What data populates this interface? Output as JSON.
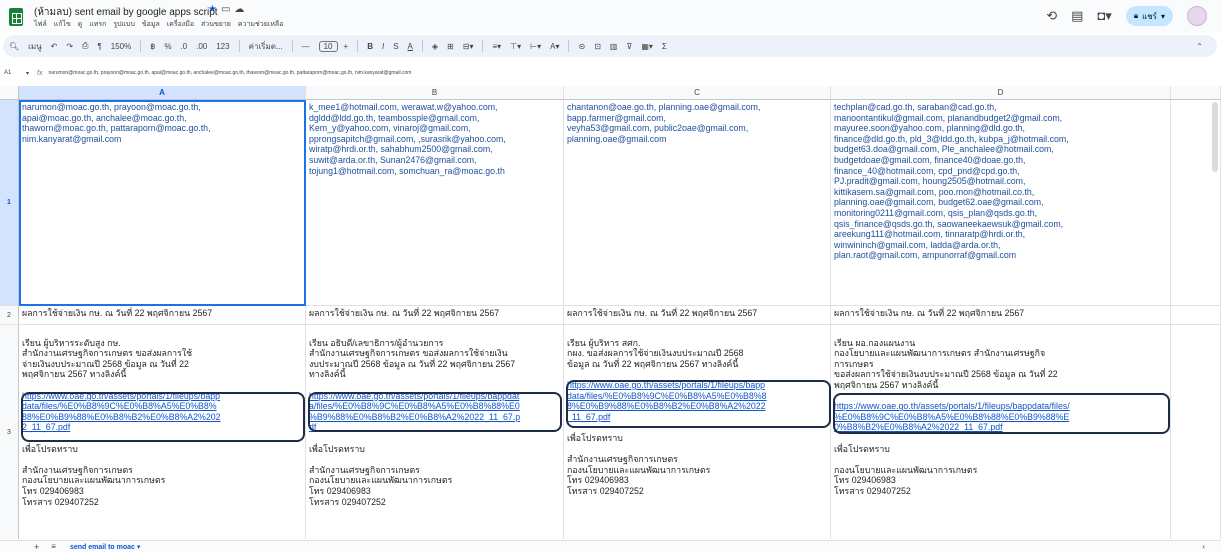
{
  "header": {
    "doc_title": "(ห้ามลบ) sent email by google apps script",
    "menu": [
      "ไฟล์",
      "แก้ไข",
      "ดู",
      "แทรก",
      "รูปแบบ",
      "ข้อมูล",
      "เครื่องมือ",
      "ส่วนขยาย",
      "ความช่วยเหลือ"
    ],
    "share_label": "แชร์"
  },
  "toolbar": {
    "menus_label": "เมนู",
    "zoom": "150%",
    "currency": "฿",
    "percent": "%",
    "dec_decrease": ".0",
    "dec_increase": ".00",
    "number_format": "123",
    "font": "ค่าเริ่มต...",
    "font_size": "10",
    "bold": "B",
    "italic": "I",
    "strike": "S",
    "text_color": "A",
    "function": "Σ"
  },
  "formula_bar": {
    "cell_ref": "A1",
    "fx": "fx",
    "content": "narumon@moac.go.th, prayoon@moac.go.th, apai@moac.go.th, anchalee@moac.go.th, thaworn@moac.go.th, pattaraporn@moac.go.th, nim.kanyarat@gmail.com"
  },
  "grid": {
    "columns": [
      "A",
      "B",
      "C",
      "D"
    ],
    "rows": [
      "1",
      "2",
      "3"
    ],
    "row1": [
      "narumon@moac.go.th, prayoon@moac.go.th,\napai@moac.go.th, anchalee@moac.go.th,\nthaworn@moac.go.th, pattaraporn@moac.go.th,\nnim.kanyarat@gmail.com",
      "k_mee1@hotmail.com, werawat.w@yahoo.com,\ndgldd@ldd.go.th, teambossple@gmail.com,\nKem_y@yahoo.com, vinaroj@gmail.com,\npprongsapitch@gmail.com, ,surasrik@yahoo.com,\nwiratp@hrdi.or.th, sahabhum2500@gmail.com,\nsuwit@arda.or.th, Sunan2476@gmail.com,\ntojung1@hotmail.com, somchuan_ra@moac.go.th",
      "chantanon@oae.go.th, planning.oae@gmail.com,\nbapp.farmer@gmail.com,\nveyha53@gmail.com, public2oae@gmail.com,\nplanning.oae@gmail.com",
      "techplan@cad.go.th, saraban@cad.go.th,\nmanoontantikul@gmail.com, planandbudget2@gmail.com,\nmayuree.soon@yahoo.com, planning@dld.go.th,\nfinance@dld.go.th, pld_3@ldd.go.th, kubpa_j@hotmail.com,\nbudget63.doa@gmail.com, Ple_anchalee@hotmail.com,\nbudgetdoae@gmail.com, finance40@doae.go.th,\nfinance_40@hotmail.com, cpd_pnd@cpd.go.th,\nPJ.pradit@gmail.com, houng2505@hotmail.com,\nkittikasem.sa@gmail.com, poo.mon@hotmail.co.th,\nplanning.oae@gmail.com, budget62.oae@gmail.com,\nmonitoring0211@gmail.com, qsis_plan@qsds.go.th,\nqsis_finance@qsds.go.th, saowaneekaewsuk@gmail.com,\nareekung111@hotmail.com, tinnaratp@hrdi.or.th,\nwinwininch@gmail.com, ladda@arda.or.th,\nplan.raot@gmail.com, ampunorraf@gmail.com"
    ],
    "row2": [
      "ผลการใช้จ่ายเงิน กษ. ณ วันที่ 22 พฤศจิกายน 2567",
      "ผลการใช้จ่ายเงิน กษ. ณ วันที่ 22 พฤศจิกายน 2567",
      "ผลการใช้จ่ายเงิน กษ. ณ วันที่ 22 พฤศจิกายน 2567",
      "ผลการใช้จ่ายเงิน กษ. ณ วันที่ 22 พฤศจิกายน 2567"
    ],
    "row3_intro": [
      "เรียน ผู้บริหารระดับสูง กษ.\n        สำนักงานเศรษฐกิจการเกษตร  ขอส่งผลการใช้\nจ่ายเงินงบประมาณปี 2568 ข้อมูล ณ วันที่ 22\nพฤศจิกายน 2567 ทางลิงค์นี้",
      "เรียน อธิบดี/เลขาธิการ/ผู้อำนวยการ\n        สำนักงานเศรษฐกิจการเกษตร  ขอส่งผลการใช้จ่ายเงิน\nงบประมาณปี 2568 ข้อมูล ณ วันที่ 22 พฤศจิกายน 2567\nทางลิงค์นี้",
      "เรียน ผู้บริหาร สศก.\n        กผง. ขอส่งผลการใช้จ่ายเงินงบประมาณปี 2568\nข้อมูล ณ วันที่ 22 พฤศจิกายน 2567 ทางลิงค์นี้",
      "เรียน  ผอ.กองแผนงาน\n        กองโยบายและแผนพัฒนาการเกษตร สำนักงานเศรษฐกิจ\nการเกษตร\n ขอส่งผลการใช้จ่ายเงินงบประมาณปี 2568 ข้อมูล ณ วันที่ 22\nพฤศจิกายน 2567 ทางลิงค์นี้"
    ],
    "row3_link": [
      "https://www.oae.go.th/assets/portals/1/fileups/bapp\ndata/files/%E0%B8%9C%E0%B8%A5%E0%B8%\n88%E0%B9%88%E0%B8%B2%E0%B8%A2%202\n2_11_67.pdf",
      "https://www.oae.go.th/assets/portals/1/fileups/bappdat\na/files/%E0%B8%9C%E0%B8%A5%E0%B8%88%E0\n%B9%88%E0%B8%B2%E0%B8%A2%2022_11_67.p\ndf",
      "https://www.oae.go.th/assets/portals/1/fileups/bapp\ndata/files/%E0%B8%9C%E0%B8%A5%E0%B8%8\n8%E0%B9%88%E0%B8%B2%E0%B8%A2%2022\n_11_67.pdf",
      "https://www.oae.go.th/assets/portals/1/fileups/bappdata/files/\n%E0%B8%9C%E0%B8%A5%E0%B8%88%E0%B9%88%E\n0%B8%B2%E0%B8%A2%2022_11_67.pdf"
    ],
    "row3_outro": [
      "เพื่อโปรดทราบ\n\nสำนักงานเศรษฐกิจการเกษตร\nกองนโยบายและแผนพัฒนาการเกษตร\nโทร 029406983\nโทรสาร  029407252",
      "เพื่อโปรดทราบ\n\nสำนักงานเศรษฐกิจการเกษตร\nกองนโยบายและแผนพัฒนาการเกษตร\nโทร 029406983\nโทรสาร  029407252",
      "เพื่อโปรดทราบ\n\nสำนักงานเศรษฐกิจการเกษตร\nกองนโยบายและแผนพัฒนาการเกษตร\nโทร 029406983\nโทรสาร  029407252",
      "เพื่อโปรดทราบ\n\nกองนโยบายและแผนพัฒนาการเกษตร\nโทร 029406983\nโทรสาร  029407252"
    ]
  },
  "bottom": {
    "add": "+",
    "list": "≡",
    "sheet_tab": "send email to moac"
  },
  "colors": {
    "selection": "#1a73e8",
    "highlight_outline": "#1e2c4a",
    "link": "#1155cc",
    "sheets_green": "#188038"
  },
  "icons": [
    "sheets-logo-icon",
    "star-icon",
    "folder-icon",
    "cloud-icon",
    "history-icon",
    "comment-icon",
    "meet-icon",
    "lock-icon",
    "undo-icon",
    "redo-icon",
    "print-icon",
    "paint-format-icon"
  ]
}
